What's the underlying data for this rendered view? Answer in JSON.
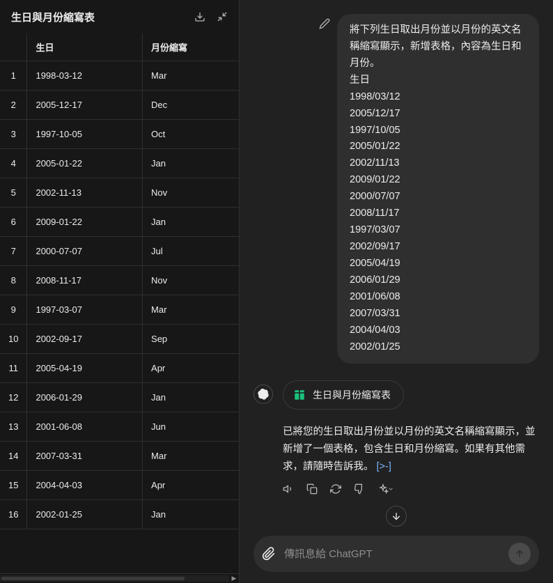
{
  "panel": {
    "title": "生日與月份縮寫表",
    "headers": [
      "",
      "生日",
      "月份縮寫"
    ],
    "rows": [
      {
        "n": "1",
        "b": "1998-03-12",
        "m": "Mar"
      },
      {
        "n": "2",
        "b": "2005-12-17",
        "m": "Dec"
      },
      {
        "n": "3",
        "b": "1997-10-05",
        "m": "Oct"
      },
      {
        "n": "4",
        "b": "2005-01-22",
        "m": "Jan"
      },
      {
        "n": "5",
        "b": "2002-11-13",
        "m": "Nov"
      },
      {
        "n": "6",
        "b": "2009-01-22",
        "m": "Jan"
      },
      {
        "n": "7",
        "b": "2000-07-07",
        "m": "Jul"
      },
      {
        "n": "8",
        "b": "2008-11-17",
        "m": "Nov"
      },
      {
        "n": "9",
        "b": "1997-03-07",
        "m": "Mar"
      },
      {
        "n": "10",
        "b": "2002-09-17",
        "m": "Sep"
      },
      {
        "n": "11",
        "b": "2005-04-19",
        "m": "Apr"
      },
      {
        "n": "12",
        "b": "2006-01-29",
        "m": "Jan"
      },
      {
        "n": "13",
        "b": "2001-06-08",
        "m": "Jun"
      },
      {
        "n": "14",
        "b": "2007-03-31",
        "m": "Mar"
      },
      {
        "n": "15",
        "b": "2004-04-03",
        "m": "Apr"
      },
      {
        "n": "16",
        "b": "2002-01-25",
        "m": "Jan"
      }
    ]
  },
  "chat": {
    "user_lines": [
      "將下列生日取出月份並以月份的英文名稱縮寫顯示，新增表格，內容為生日和月份。",
      "生日",
      "1998/03/12",
      "2005/12/17",
      "1997/10/05",
      "2005/01/22",
      "2002/11/13",
      "2009/01/22",
      "2000/07/07",
      "2008/11/17",
      "1997/03/07",
      "2002/09/17",
      "2005/04/19",
      "2006/01/29",
      "2001/06/08",
      "2007/03/31",
      "2004/04/03",
      "2002/01/25"
    ],
    "artifact_label": "生日與月份縮寫表",
    "assistant_text": "已將您的生日取出月份並以月份的英文名稱縮寫顯示，並新增了一個表格，包含生日和月份縮寫。如果有其他需求，請隨時告訴我。 ",
    "link_text": "[>-]"
  },
  "compose": {
    "placeholder": "傳訊息給 ChatGPT"
  }
}
